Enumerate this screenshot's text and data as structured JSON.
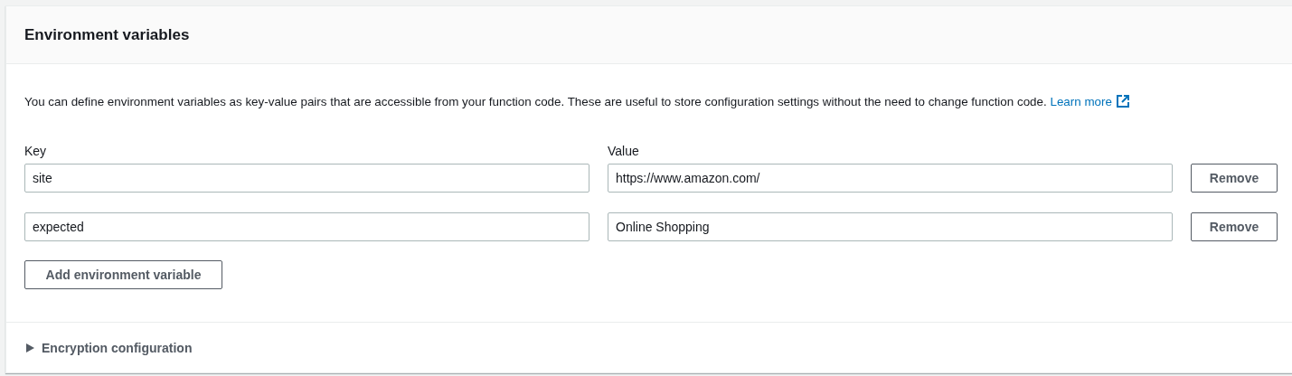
{
  "panel": {
    "title": "Environment variables",
    "description": "You can define environment variables as key-value pairs that are accessible from your function code. These are useful to store configuration settings without the need to change function code.",
    "learn_more": "Learn more",
    "columns": [
      "Key",
      "Value"
    ],
    "variables": [
      {
        "key": "site",
        "value": "https://www.amazon.com/",
        "remove": "Remove"
      },
      {
        "key": "expected",
        "value": "Online Shopping",
        "remove": "Remove"
      }
    ],
    "add_button": "Add environment variable",
    "encryption": {
      "label": "Encryption configuration",
      "expanded": false
    }
  }
}
